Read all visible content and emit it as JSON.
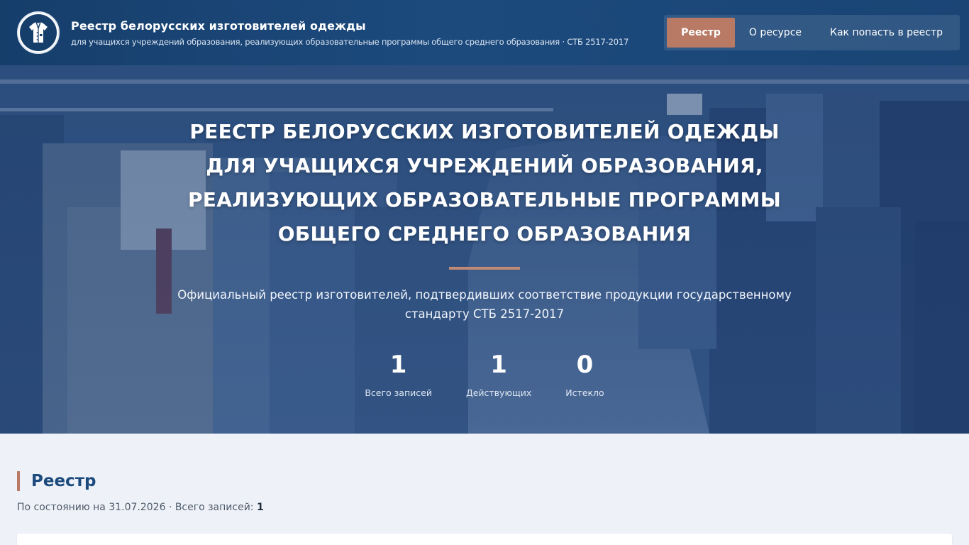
{
  "header": {
    "title": "Реестр белорусских изготовителей одежды",
    "subtitle": "для учащихся учреждений образования, реализующих образовательные программы общего среднего образования · СТБ 2517-2017",
    "logo_icon": "clothing-emblem-icon"
  },
  "nav": {
    "items": [
      {
        "label": "Реестр",
        "active": true
      },
      {
        "label": "О ресурсе",
        "active": false
      },
      {
        "label": "Как попасть в реестр",
        "active": false
      }
    ]
  },
  "hero": {
    "title": "РЕЕСТР БЕЛОРУССКИХ ИЗГОТОВИТЕЛЕЙ ОДЕЖДЫ ДЛЯ УЧАЩИХСЯ УЧРЕЖДЕНИЙ ОБРАЗОВАНИЯ, РЕАЛИЗУЮЩИХ ОБРАЗОВАТЕЛЬНЫЕ ПРОГРАММЫ ОБЩЕГО СРЕДНЕГО ОБРАЗОВАНИЯ",
    "description": "Официальный реестр изготовителей, подтвердивших соответствие продукции государственному стандарту СТБ 2517-2017",
    "stats": [
      {
        "value": "1",
        "label": "Всего записей"
      },
      {
        "value": "1",
        "label": "Действующих"
      },
      {
        "value": "0",
        "label": "Истекло"
      }
    ]
  },
  "section": {
    "title": "Реестр",
    "meta_prefix": "По состоянию на 31.07.2026 · Всего записей: ",
    "meta_count": "1"
  },
  "colors": {
    "header_bg": "#1c4a7d",
    "accent": "#b87a65",
    "page_bg": "#eef2f8",
    "heading": "#1c4a7d"
  }
}
